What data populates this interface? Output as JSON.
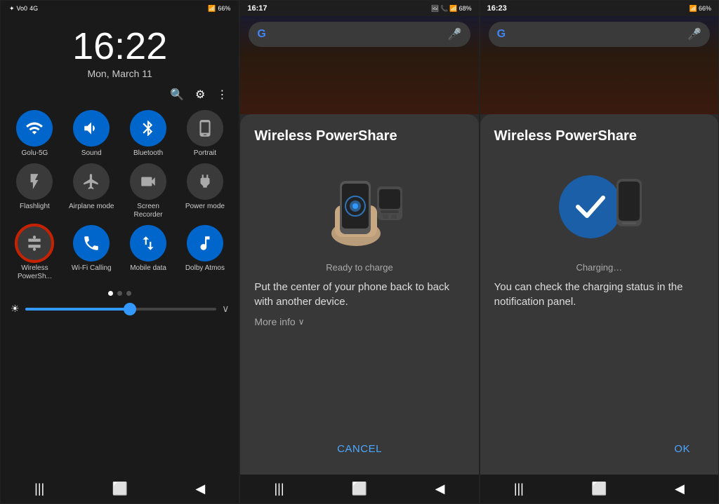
{
  "panel1": {
    "time": "16:22",
    "date": "Mon, March 11",
    "status": "66%",
    "tiles": [
      {
        "id": "wifi",
        "label": "Golu-5G",
        "active": true,
        "icon": "📶"
      },
      {
        "id": "sound",
        "label": "Sound",
        "active": true,
        "icon": "🔊"
      },
      {
        "id": "bluetooth",
        "label": "Bluetooth",
        "active": true,
        "icon": "🔵"
      },
      {
        "id": "portrait",
        "label": "Portrait",
        "active": false,
        "icon": "📱"
      },
      {
        "id": "flashlight",
        "label": "Flashlight",
        "active": false,
        "icon": "🔦"
      },
      {
        "id": "airplane",
        "label": "Airplane mode",
        "active": false,
        "icon": "✈"
      },
      {
        "id": "screen-recorder",
        "label": "Screen Recorder",
        "active": false,
        "icon": "🎥"
      },
      {
        "id": "power-mode",
        "label": "Power mode",
        "active": false,
        "icon": "⚡"
      },
      {
        "id": "wireless-ps",
        "label": "Wireless PowerSh...",
        "active": false,
        "icon": "🔋",
        "highlighted": true
      },
      {
        "id": "wifi-calling",
        "label": "Wi-Fi Calling",
        "active": true,
        "icon": "📞"
      },
      {
        "id": "mobile-data",
        "label": "Mobile data",
        "active": true,
        "icon": "↕"
      },
      {
        "id": "dolby",
        "label": "Dolby Atmos",
        "active": true,
        "icon": "🎵"
      }
    ],
    "nav": {
      "back": "◀",
      "home": "⬜",
      "recent": "|||"
    }
  },
  "panel2": {
    "status_time": "16:17",
    "status_battery": "68%",
    "title": "Wireless PowerShare",
    "status_label": "Ready to charge",
    "description": "Put the center of your phone back to back with another device.",
    "more_info": "More info",
    "cancel_btn": "Cancel"
  },
  "panel3": {
    "status_time": "16:23",
    "status_battery": "66%",
    "title": "Wireless PowerShare",
    "status_label": "Charging…",
    "description": "You can check the charging status in the notification panel.",
    "ok_btn": "OK"
  },
  "icons": {
    "search": "🔍",
    "settings": "⚙",
    "more": "⋮",
    "bluetooth_sym": "ᛒ",
    "chevron_down": "∨",
    "mic": "🎤"
  }
}
